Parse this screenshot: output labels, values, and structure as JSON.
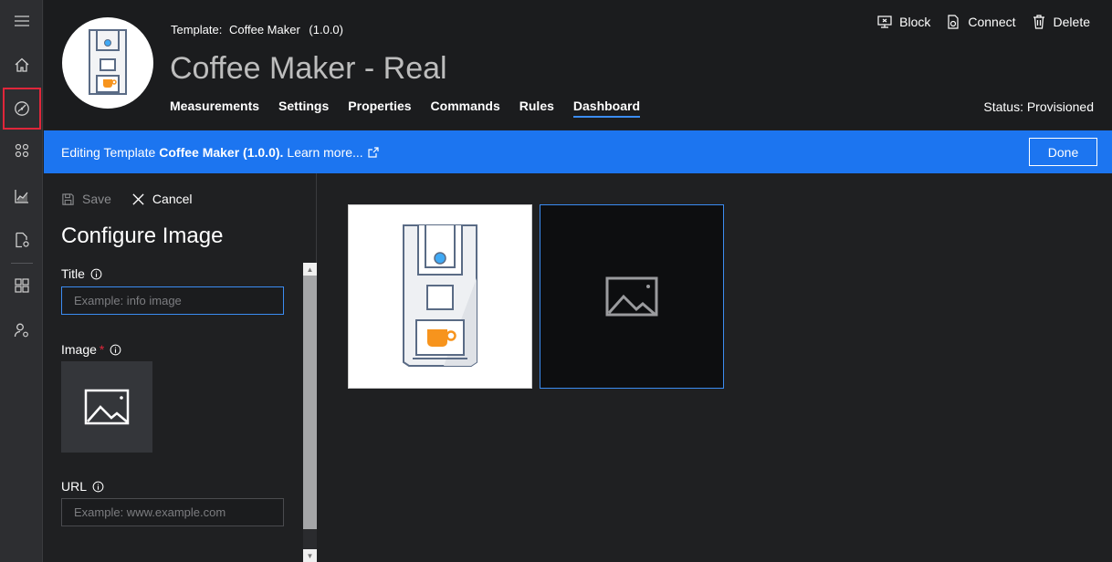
{
  "nav": {
    "items": [
      "menu-icon",
      "home-icon",
      "device-templates-icon",
      "devices-icon",
      "analytics-icon",
      "jobs-icon",
      "dashboards-icon",
      "administration-icon"
    ]
  },
  "header": {
    "template_label": "Template:",
    "template_name": "Coffee Maker",
    "template_version": "(1.0.0)",
    "title": "Coffee Maker - Real",
    "tabs": [
      "Measurements",
      "Settings",
      "Properties",
      "Commands",
      "Rules",
      "Dashboard"
    ],
    "active_tab": "Dashboard",
    "actions": {
      "block": "Block",
      "connect": "Connect",
      "delete": "Delete"
    },
    "status": "Status: Provisioned"
  },
  "banner": {
    "prefix": "Editing Template",
    "template": "Coffee Maker (1.0.0).",
    "link": "Learn more...",
    "done": "Done",
    "color": "#1c75f0"
  },
  "panel": {
    "save": "Save",
    "cancel": "Cancel",
    "title": "Configure Image",
    "title_field": {
      "label": "Title",
      "placeholder": "Example: info image",
      "value": ""
    },
    "image_field": {
      "label": "Image",
      "required_mark": "*"
    },
    "url_field": {
      "label": "URL",
      "placeholder": "Example: www.example.com",
      "value": ""
    }
  },
  "colors": {
    "accent": "#3b8cf2",
    "coffee_cup": "#f7941d",
    "indicator": "#3fa9f5"
  }
}
